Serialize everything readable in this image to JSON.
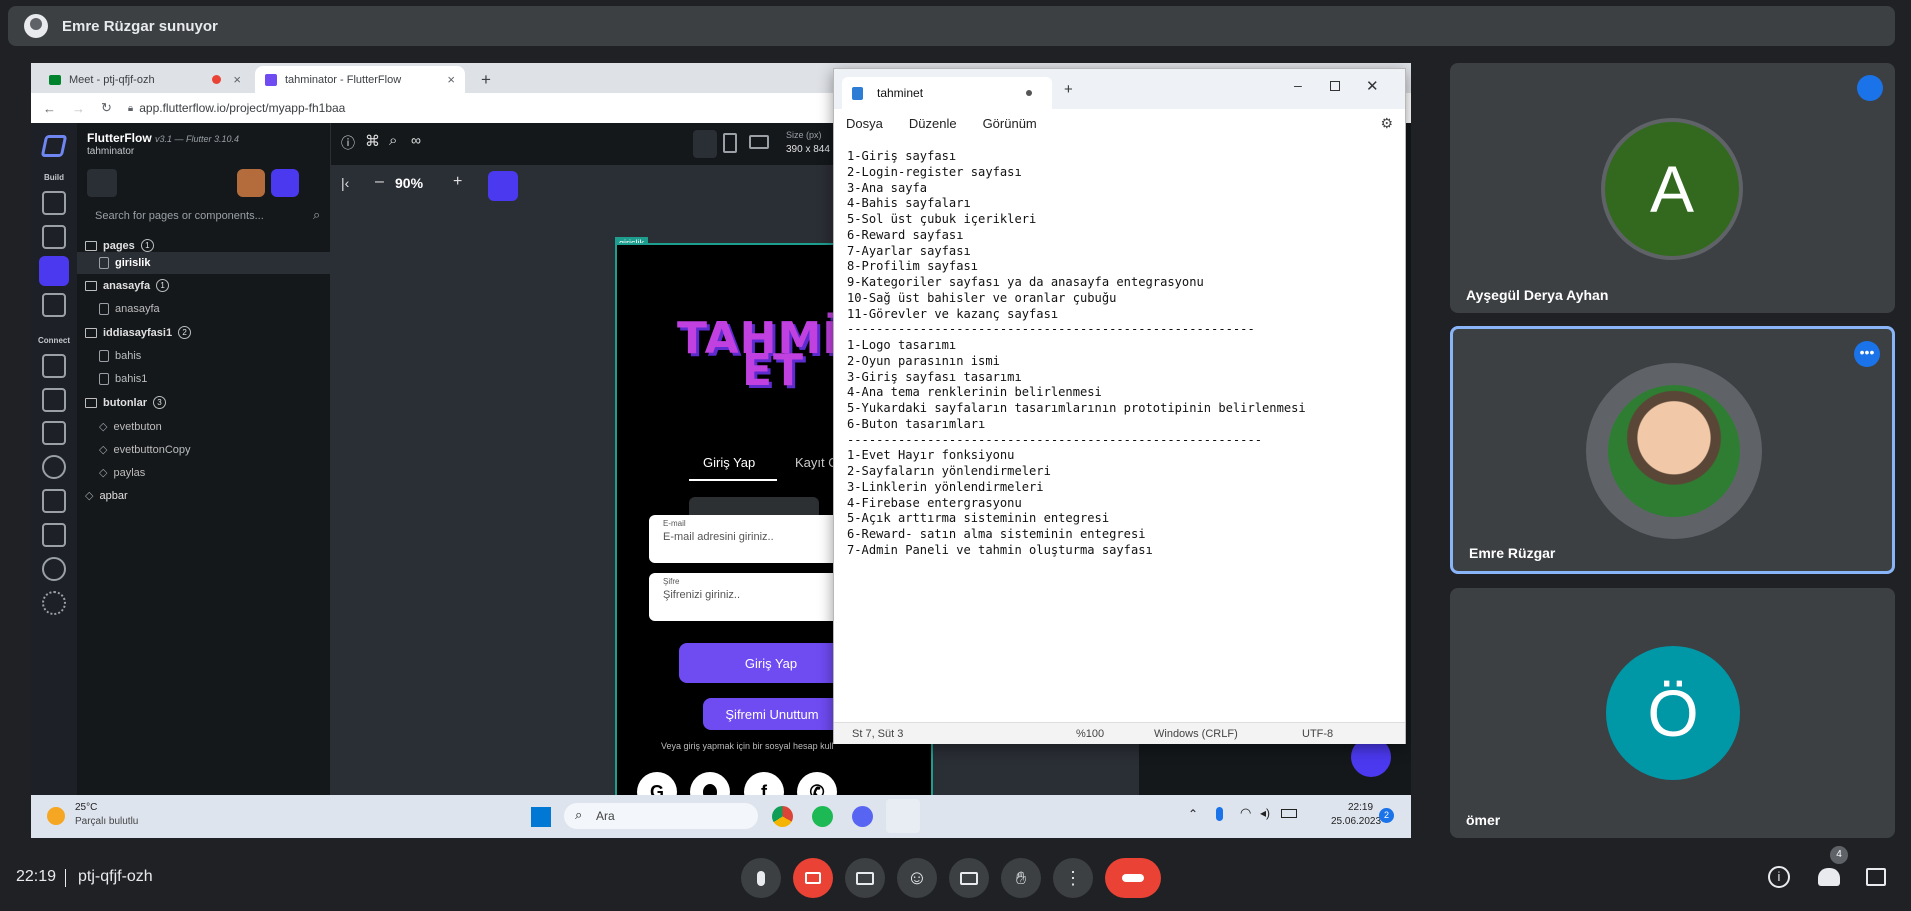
{
  "presenter_bar": {
    "text": "Emre Rüzgar sunuyor"
  },
  "browser": {
    "tabs": [
      {
        "label": "Meet - ptj-qfjf-ozh",
        "close": "×"
      },
      {
        "label": "tahminator - FlutterFlow",
        "close": "×"
      }
    ],
    "new_tab": "+",
    "url": "app.flutterflow.io/project/myapp-fh1baa"
  },
  "flutterflow": {
    "app_name": "FlutterFlow",
    "version": "v3.1 — Flutter 3.10.4",
    "project": "tahminator",
    "rail_build": "Build",
    "rail_connect": "Connect",
    "search_placeholder": "Search for pages or components...",
    "tree": {
      "pages": "pages",
      "pages_count": "1",
      "girislik": "girislik",
      "anasayfa_folder": "anasayfa",
      "anasayfa_count": "1",
      "anasayfa": "anasayfa",
      "iddiasayfasi": "iddiasayfasi1",
      "iddia_count": "2",
      "bahis": "bahis",
      "bahis1": "bahis1",
      "butonlar": "butonlar",
      "butonlar_count": "3",
      "evetbuton": "evetbuton",
      "evetbuttonCopy": "evetbuttonCopy",
      "paylas": "paylas",
      "apbar": "apbar"
    },
    "zoom": "90%",
    "size_label": "Size (px)",
    "size_value": "390 x 844",
    "page_tag": "girislik"
  },
  "phone": {
    "logo_line1": "TAHMİN",
    "logo_line2": "ET",
    "tab_login": "Giriş Yap",
    "tab_register": "Kayıt Ol",
    "email_label": "E-mail",
    "email_placeholder": "E-mail adresini giriniz..",
    "password_label": "Şifre",
    "password_placeholder": "Şifrenizi giriniz..",
    "login_button": "Giriş Yap",
    "forgot_button": "Şifremi Unuttum",
    "social_hint": "Veya giriş yapmak için bir sosyal hesap kull",
    "social": [
      "G",
      "",
      "f",
      "✆"
    ]
  },
  "notepad": {
    "tab_title": "tahminet",
    "menu": [
      "Dosya",
      "Düzenle",
      "Görünüm"
    ],
    "content": "1-Giriş sayfası\n2-Login-register sayfası\n3-Ana sayfa\n4-Bahis sayfaları\n5-Sol üst çubuk içerikleri\n6-Reward sayfası\n7-Ayarlar sayfası\n8-Profilim sayfası\n9-Kategoriler sayfası ya da anasayfa entegrasyonu\n10-Sağ üst bahisler ve oranlar çubuğu\n11-Görevler ve kazanç sayfası\n--------------------------------------------------------\n1-Logo tasarımı\n2-Oyun parasının ismi\n3-Giriş sayfası tasarımı\n4-Ana tema renklerinin belirlenmesi\n5-Yukardaki sayfaların tasarımlarının prototipinin belirlenmesi\n6-Buton tasarımları\n---------------------------------------------------------\n1-Evet Hayır fonksiyonu\n2-Sayfaların yönlendirmeleri\n3-Linklerin yönlendirmeleri\n4-Firebase entergrasyonu\n5-Açık arttırma sisteminin entegresi\n6-Reward- satın alma sisteminin entegresi\n7-Admin Paneli ve tahmin oluşturma sayfası",
    "status_position": "St 7, Süt 3",
    "status_zoom": "%100",
    "status_eol": "Windows (CRLF)",
    "status_encoding": "UTF-8"
  },
  "taskbar": {
    "weather_temp": "25°C",
    "weather_desc": "Parçalı bulutlu",
    "search": "Ara",
    "time": "22:19",
    "date": "25.06.2023",
    "notif": "2"
  },
  "participants": [
    {
      "name": "Ayşegül Derya Ayhan",
      "initial": "A",
      "color": "#33691e"
    },
    {
      "name": "Emre Rüzgar",
      "initial": "",
      "color": "#5f6368"
    },
    {
      "name": "ömer",
      "initial": "Ö",
      "color": "#0097a7"
    }
  ],
  "meet": {
    "time": "22:19",
    "meeting_code": "ptj-qfjf-ozh",
    "people_count": "4"
  },
  "colors": {
    "accent": "#1a73e8",
    "end_call": "#ea4335",
    "cam_off": "#ea4335",
    "ff_purple": "#6f4bf2"
  }
}
